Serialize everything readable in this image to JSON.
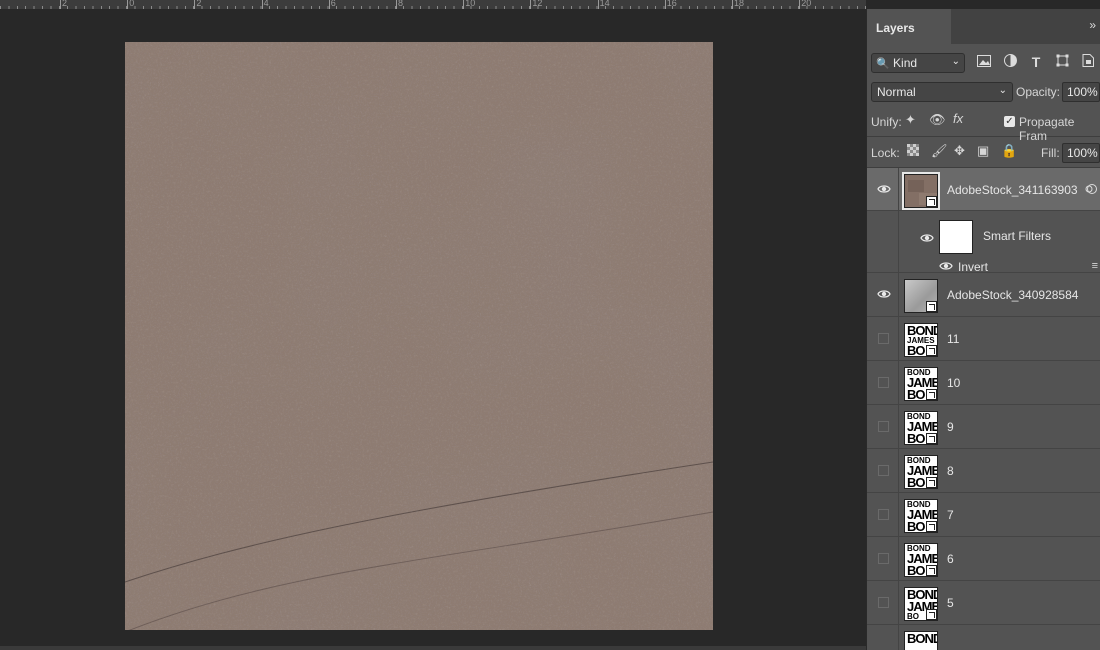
{
  "ruler": {
    "labels": [
      "2",
      "0",
      "2",
      "4",
      "6",
      "8",
      "10",
      "12",
      "14",
      "16",
      "18",
      "20",
      "22",
      "24",
      "26",
      "28"
    ]
  },
  "canvas": {
    "image_icon": "textured-stone-image",
    "texture_base_color": "#8e7b71",
    "texture_dark_color": "#4a3d3b",
    "texture_light_color": "#b09c8d"
  },
  "panel": {
    "tab_label": "Layers",
    "collapse_icon": "double-chevron-right-icon",
    "filter": {
      "kind_label": "Kind",
      "icons": [
        "image-filter-icon",
        "adjustment-filter-icon",
        "type-filter-icon",
        "shape-filter-icon",
        "smart-object-filter-icon"
      ]
    },
    "blend_mode": "Normal",
    "opacity_label": "Opacity:",
    "opacity_value": "100%",
    "unify_label": "Unify:",
    "propagate_label": "Propagate Fram",
    "lock_label": "Lock:",
    "fill_label": "Fill:",
    "fill_value": "100%"
  },
  "layers": [
    {
      "name": "AdobeStock_341163903",
      "visible": true,
      "selected": true,
      "thumb": "stone-texture"
    },
    {
      "name": "AdobeStock_340928584",
      "visible": true,
      "selected": false,
      "thumb": "metal-texture"
    },
    {
      "name": "11",
      "visible": false,
      "thumb": "bond-text"
    },
    {
      "name": "10",
      "visible": false,
      "thumb": "bond-text"
    },
    {
      "name": "9",
      "visible": false,
      "thumb": "bond-text"
    },
    {
      "name": "8",
      "visible": false,
      "thumb": "bond-text"
    },
    {
      "name": "7",
      "visible": false,
      "thumb": "bond-text"
    },
    {
      "name": "6",
      "visible": false,
      "thumb": "bond-text"
    },
    {
      "name": "5",
      "visible": false,
      "thumb": "bond-text"
    }
  ],
  "smart_filters": {
    "label": "Smart Filters",
    "filter_name": "Invert"
  },
  "bond_thumb": {
    "line1": "BOND",
    "line2": "JAMES",
    "line3": "BO"
  }
}
